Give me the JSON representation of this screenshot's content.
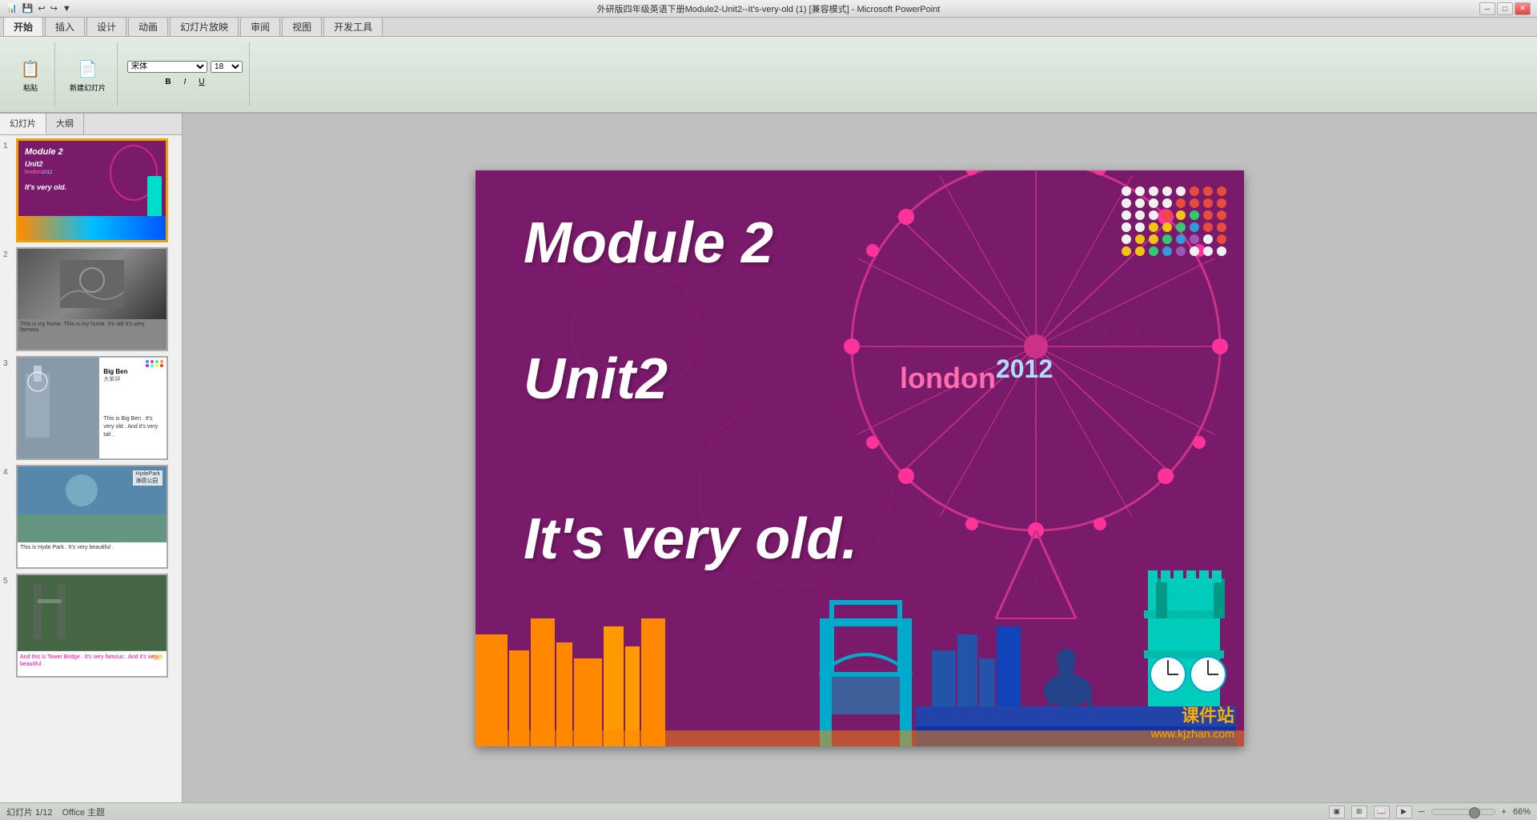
{
  "titlebar": {
    "title": "外研版四年级英语下册Module2-Unit2--It's-very-old (1) [兼容模式] - Microsoft PowerPoint",
    "app_icon": "📊",
    "min_btn": "─",
    "max_btn": "□",
    "close_btn": "✕"
  },
  "quickaccess": {
    "save": "💾",
    "undo": "↩",
    "redo": "↪",
    "more": "▼"
  },
  "ribbon": {
    "tabs": [
      "开始",
      "插入",
      "设计",
      "动画",
      "幻灯片放映",
      "审阅",
      "视图",
      "开发工具"
    ]
  },
  "slidepanel": {
    "tabs": [
      "幻灯片",
      "大纲"
    ],
    "slides": [
      {
        "num": "1",
        "selected": true,
        "caption": ""
      },
      {
        "num": "2",
        "selected": false,
        "caption": "This is my home. This is my home.\nIt's old         It's very famous."
      },
      {
        "num": "3",
        "selected": false,
        "caption": "This is Big Ben . It's very old .\nAnd it's very tall ."
      },
      {
        "num": "4",
        "selected": false,
        "caption": "This is Hyde Park .\nIt's very beautiful ."
      },
      {
        "num": "5",
        "selected": false,
        "caption": "And this is Tower Bridge .\nIt's very famous .\nAnd it's very beautiful ."
      }
    ]
  },
  "mainslide": {
    "module_label": "Module 2",
    "unit_label": "Unit2",
    "london_label": "london",
    "year_label": "2012",
    "tagline": "It's  very  old.",
    "london_color": "#ff6eb0",
    "year_color": "#aaddff"
  },
  "statusbar": {
    "slide_info": "幻灯片 1/12",
    "theme": "Office 主题",
    "zoom_percent": "66%"
  },
  "dots": {
    "colors": [
      "#e74c3c",
      "#e74c3c",
      "#e74c3c",
      "#e74c3c",
      "#2ecc71",
      "#3498db",
      "#9b59b6",
      "#ecf0f1",
      "#e74c3c",
      "#e74c3c",
      "#e74c3c",
      "#f1c40f",
      "#2ecc71",
      "#3498db",
      "#9b59b6",
      "#ecf0f1",
      "#e74c3c",
      "#e74c3c",
      "#f1c40f",
      "#f1c40f",
      "#2ecc71",
      "#3498db",
      "#9b59b6",
      "#ecf0f1",
      "#e74c3c",
      "#f1c40f",
      "#f1c40f",
      "#f1c40f",
      "#2ecc71",
      "#3498db",
      "#9b59b6",
      "#ecf0f1",
      "#f1c40f",
      "#f1c40f",
      "#f1c40f",
      "#f1c40f",
      "#2ecc71",
      "#3498db",
      "#9b59b6",
      "#ecf0f1",
      "#ecf0f1",
      "#ecf0f1",
      "#ecf0f1",
      "#ecf0f1",
      "#ecf0f1",
      "#ecf0f1",
      "#ecf0f1",
      "#ecf0f1"
    ]
  },
  "slide3": {
    "title": "Big Ben",
    "subtitle": "大笨钟"
  },
  "slide4": {
    "title": "HydePark",
    "subtitle": "海德公园"
  },
  "slide5": {
    "label": "塔桥"
  }
}
